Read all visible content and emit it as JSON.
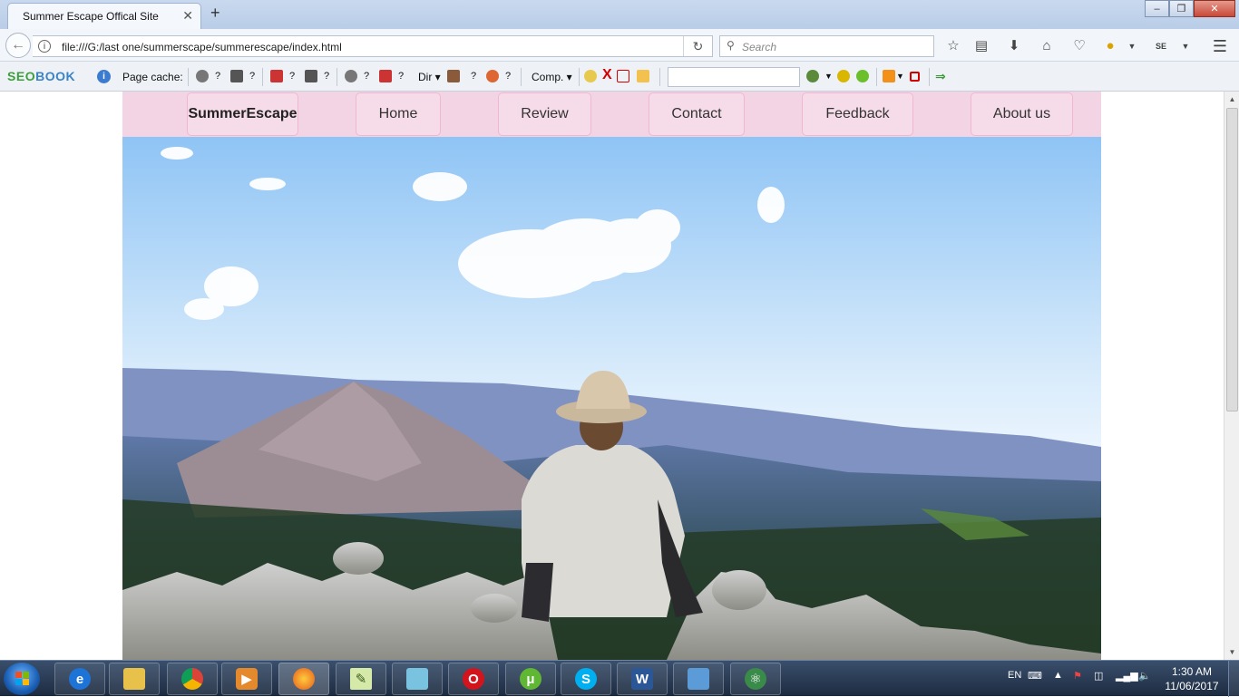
{
  "browser": {
    "tab_title": "Summer Escape Offical Site",
    "tab_close": "✕",
    "new_tab": "+",
    "url": "file:///G:/last one/summerscape/summerescape/index.html",
    "search_placeholder": "Search"
  },
  "seo_toolbar": {
    "logo_part1": "SE",
    "logo_part2": "O",
    "logo_part3": "BOOK",
    "page_cache_label": "Page cache:",
    "dir_label": "Dir",
    "comp_label": "Comp.",
    "question": "?"
  },
  "site": {
    "brand": "SummerEscape",
    "nav": [
      {
        "label": "Home"
      },
      {
        "label": "Review"
      },
      {
        "label": "Contact"
      },
      {
        "label": "Feedback"
      },
      {
        "label": "About us"
      }
    ]
  },
  "taskbar": {
    "lang": "EN",
    "time": "1:30 AM",
    "date": "11/06/2017"
  },
  "colors": {
    "site_nav_bg": "#f3d4e4",
    "nav_border": "#f0b8d0"
  }
}
